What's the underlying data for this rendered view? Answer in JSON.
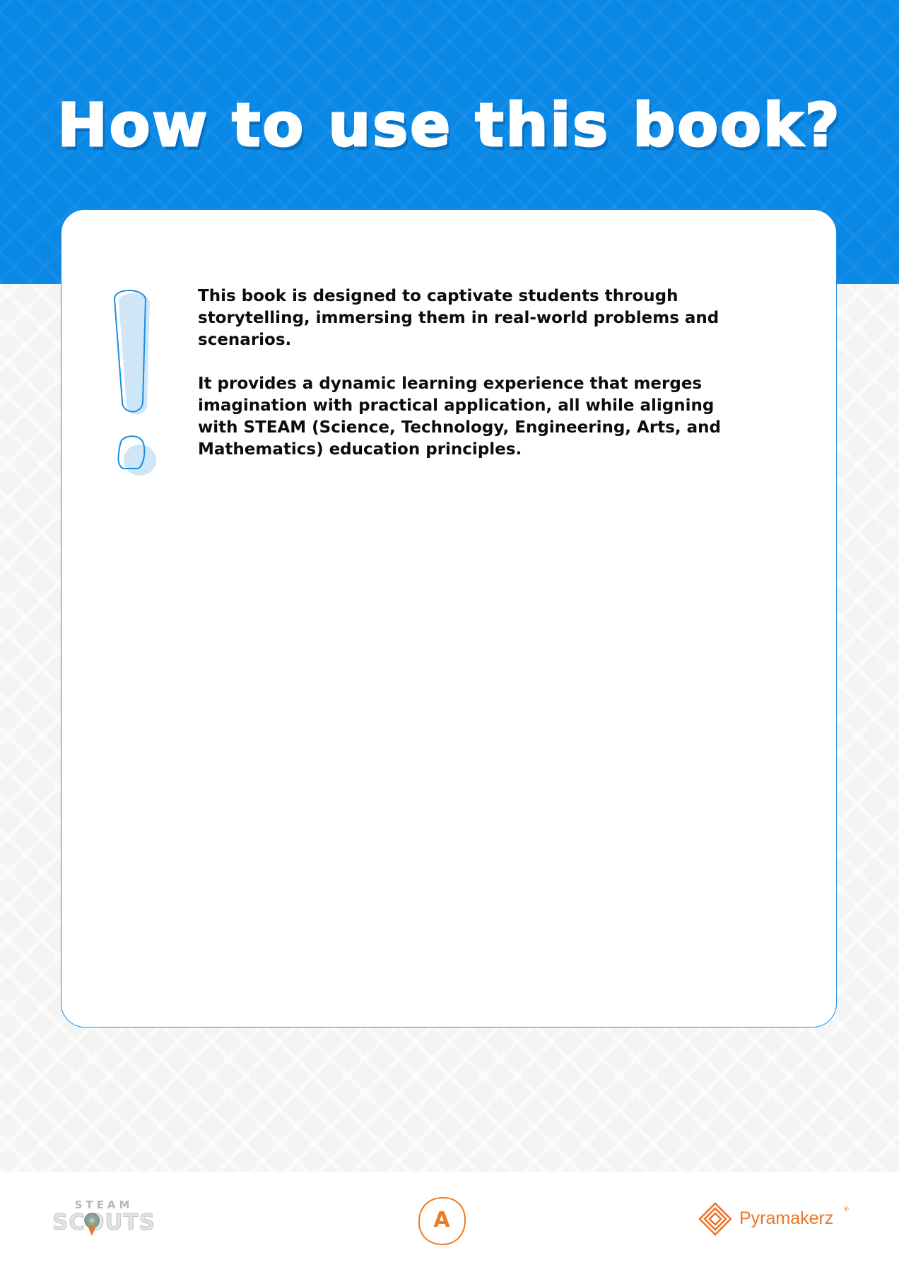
{
  "header": {
    "title": "How to use this book?"
  },
  "content": {
    "paragraphs": [
      "This book is designed to captivate students through storytelling, immersing them in real-world problems and scenarios.",
      "It provides a dynamic learning experience that merges imagination with practical application, all while aligning with STEAM (Science, Technology, Engineering, Arts, and Mathematics) education principles."
    ],
    "icon": "exclamation-mark-icon"
  },
  "footer": {
    "left_logo": {
      "top": "STEAM",
      "main": "SCOUTS"
    },
    "page_marker": "A",
    "right_logo": {
      "name": "Pyramakerz",
      "mark": "®"
    }
  },
  "colors": {
    "header_blue": "#0a88e6",
    "card_border": "#1b8de0",
    "accent_orange": "#ee7426",
    "exclaim_fill": "#cfe6f8"
  }
}
